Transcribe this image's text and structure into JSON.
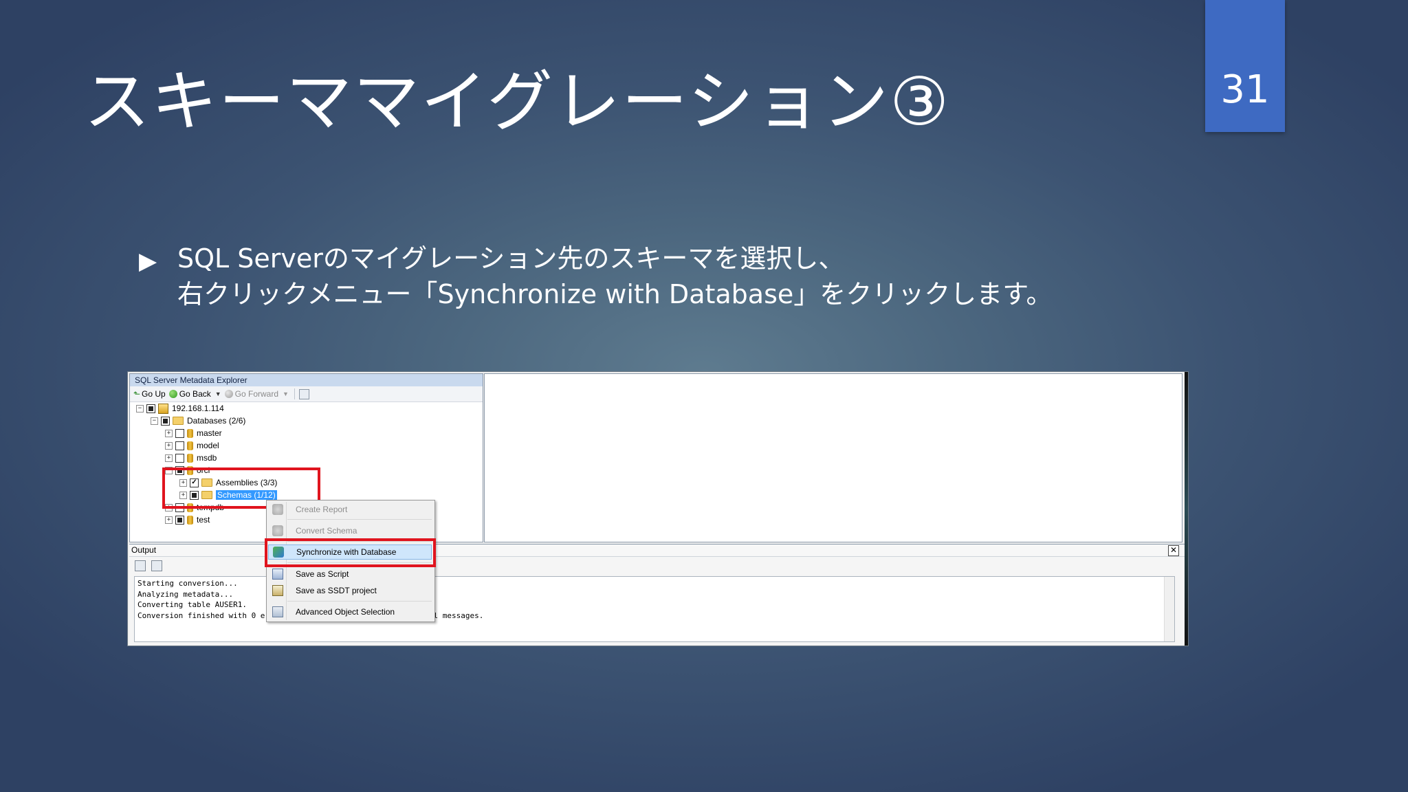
{
  "slide": {
    "title": "スキーママイグレーション③",
    "number": "31",
    "bullet": {
      "marker": "▶",
      "line1": "SQL Serverのマイグレーション先のスキーマを選択し、",
      "line2": "右クリックメニュー「Synchronize with Database」をクリックします。"
    }
  },
  "explorer": {
    "title": "SQL Server Metadata Explorer",
    "toolbar": {
      "go_up": "Go Up",
      "go_back": "Go Back",
      "go_forward": "Go Forward"
    },
    "tree": [
      {
        "label": "192.168.1.114",
        "expander": "−",
        "check": "partial",
        "icon": "server",
        "level": 0
      },
      {
        "label": "Databases (2/6)",
        "expander": "−",
        "check": "partial",
        "icon": "folder",
        "level": 1
      },
      {
        "label": "master",
        "expander": "+",
        "check": "empty",
        "icon": "database",
        "level": 2
      },
      {
        "label": "model",
        "expander": "+",
        "check": "empty",
        "icon": "database",
        "level": 2
      },
      {
        "label": "msdb",
        "expander": "+",
        "check": "empty",
        "icon": "database",
        "level": 2
      },
      {
        "label": "orcl",
        "expander": "−",
        "check": "partial",
        "icon": "database",
        "level": 2
      },
      {
        "label": "Assemblies (3/3)",
        "expander": "+",
        "check": "checked",
        "icon": "folder",
        "level": 3
      },
      {
        "label": "Schemas (1/12)",
        "expander": "+",
        "check": "partial",
        "icon": "folder",
        "level": 3,
        "selected": true
      },
      {
        "label": "tempdb",
        "expander": "+",
        "check": "empty",
        "icon": "database",
        "level": 2
      },
      {
        "label": "test",
        "expander": "+",
        "check": "partial",
        "icon": "database",
        "level": 2
      }
    ]
  },
  "output": {
    "title": "Output",
    "close": "✕",
    "lines": [
      "Starting conversion...",
      "Analyzing metadata...",
      "Converting table AUSER1.",
      "Conversion finished with 0 errors, 0 warnings, and 0 informational messages."
    ]
  },
  "context_menu": {
    "items": [
      {
        "label": "Create Report",
        "disabled": true,
        "icon": "report-icon"
      },
      {
        "label": "Convert Schema",
        "disabled": true,
        "icon": "convert-icon"
      },
      {
        "label": "Synchronize with Database",
        "disabled": false,
        "highlight": true,
        "icon": "sync-icon"
      },
      {
        "label": "Save as Script",
        "disabled": false,
        "icon": "script-icon"
      },
      {
        "label": "Save as SSDT project",
        "disabled": false,
        "icon": "ssdt-icon"
      },
      {
        "label": "Advanced Object Selection",
        "disabled": false,
        "icon": "selection-icon"
      }
    ]
  },
  "colors": {
    "accent": "#3e6ac2",
    "highlight_box": "#e0141e",
    "selection": "#3399ff"
  }
}
